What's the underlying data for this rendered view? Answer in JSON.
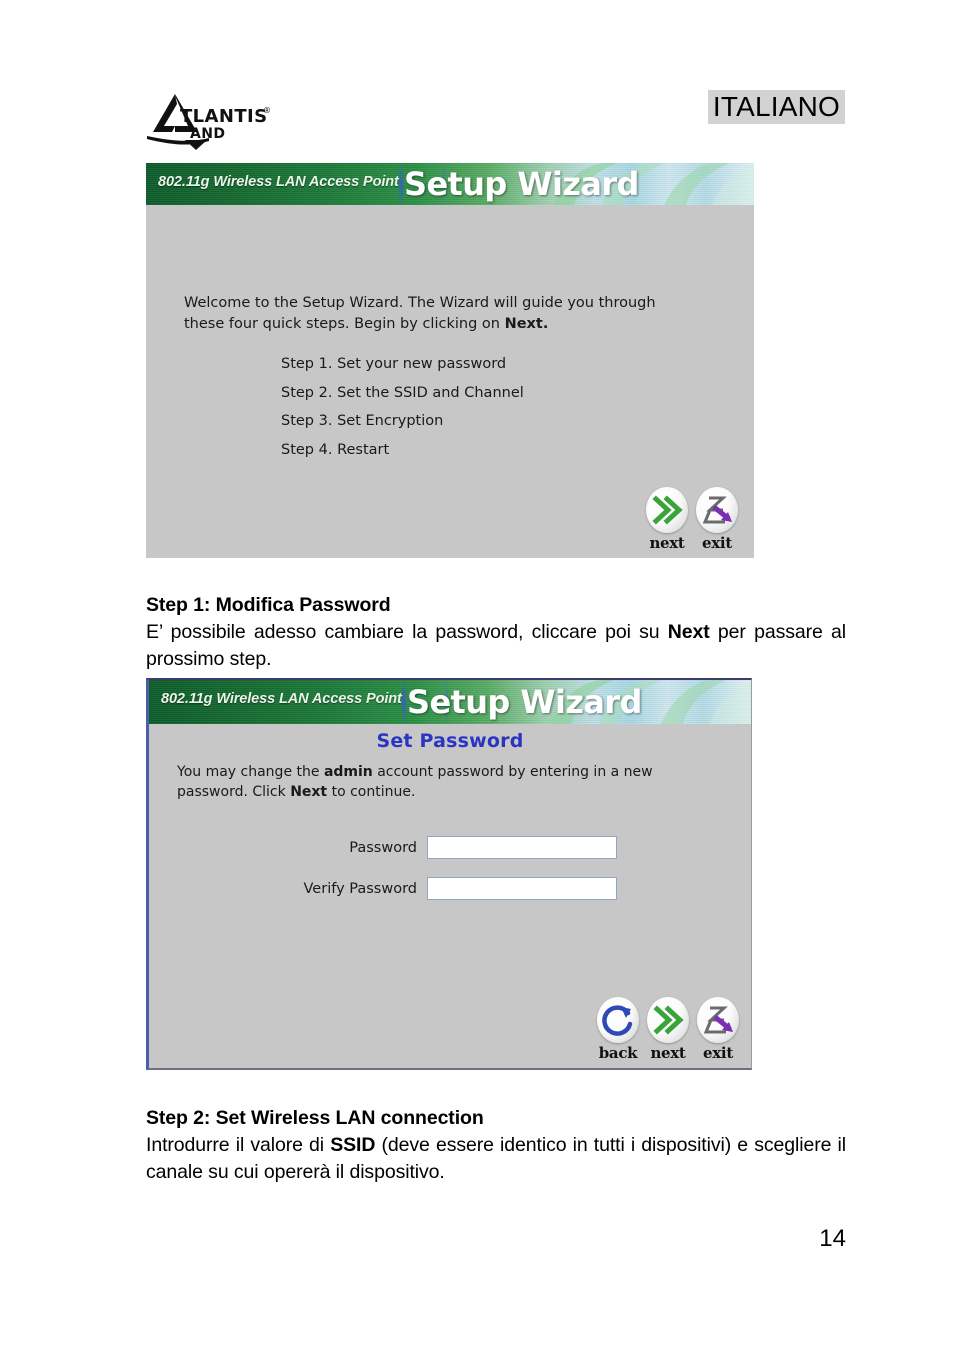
{
  "document": {
    "language_badge": "ITALIANO",
    "page_number": "14",
    "logo": {
      "brand": "ATLANTIS",
      "registered": "®",
      "sub": "LAND"
    }
  },
  "screenshot_1": {
    "banner": {
      "product": "802.11g Wireless LAN Access Point",
      "title": "Setup Wizard"
    },
    "intro_line1": "Welcome to the Setup Wizard. The Wizard will guide you through",
    "intro_line2_pre": "these four quick steps. Begin by clicking on ",
    "intro_line2_bold": "Next.",
    "steps": [
      "Step 1. Set your new password",
      "Step 2. Set the SSID and Channel",
      "Step 3. Set Encryption",
      "Step 4. Restart"
    ],
    "buttons": [
      {
        "label": "next",
        "icon": "double-chevron-right-icon",
        "color": "#3aa43a"
      },
      {
        "label": "exit",
        "icon": "exit-door-arrow-icon",
        "color": "#7b2fb5"
      }
    ]
  },
  "italian_section_1": {
    "heading": "Step 1: Modifica Password",
    "para_part1": "E’ possibile adesso cambiare la password, cliccare poi su ",
    "para_bold": "Next",
    "para_part2": " per passare al prossimo step."
  },
  "screenshot_2": {
    "banner": {
      "product": "802.11g Wireless LAN Access Point",
      "title": "Setup Wizard"
    },
    "subtitle": "Set Password",
    "intro_pre": "You may change the ",
    "intro_bold1": "admin",
    "intro_mid": " account password by entering in a new password. Click ",
    "intro_bold2": "Next",
    "intro_post": " to continue.",
    "fields": [
      {
        "label": "Password",
        "value": "",
        "placeholder": ""
      },
      {
        "label": "Verify Password",
        "value": "",
        "placeholder": ""
      }
    ],
    "buttons": [
      {
        "label": "back",
        "icon": "circular-arrow-icon",
        "color": "#2f49b5"
      },
      {
        "label": "next",
        "icon": "double-chevron-right-icon",
        "color": "#3aa43a"
      },
      {
        "label": "exit",
        "icon": "exit-door-arrow-icon",
        "color": "#7b2fb5"
      }
    ]
  },
  "italian_section_2": {
    "heading": "Step 2: Set Wireless LAN connection",
    "para_part1": "Introdurre il valore di ",
    "para_bold": "SSID",
    "para_part2": " (deve essere identico in tutti i dispositivi) e scegliere il canale su cui opererà il dispositivo."
  },
  "colors": {
    "banner_green": "#0d5c2a",
    "banner_light": "#cfe8ef",
    "panel_gray": "#c7c7c7",
    "subtitle_blue": "#2b35c2",
    "badge_gray": "#d2d2d2",
    "input_border": "#8fa7c4"
  }
}
